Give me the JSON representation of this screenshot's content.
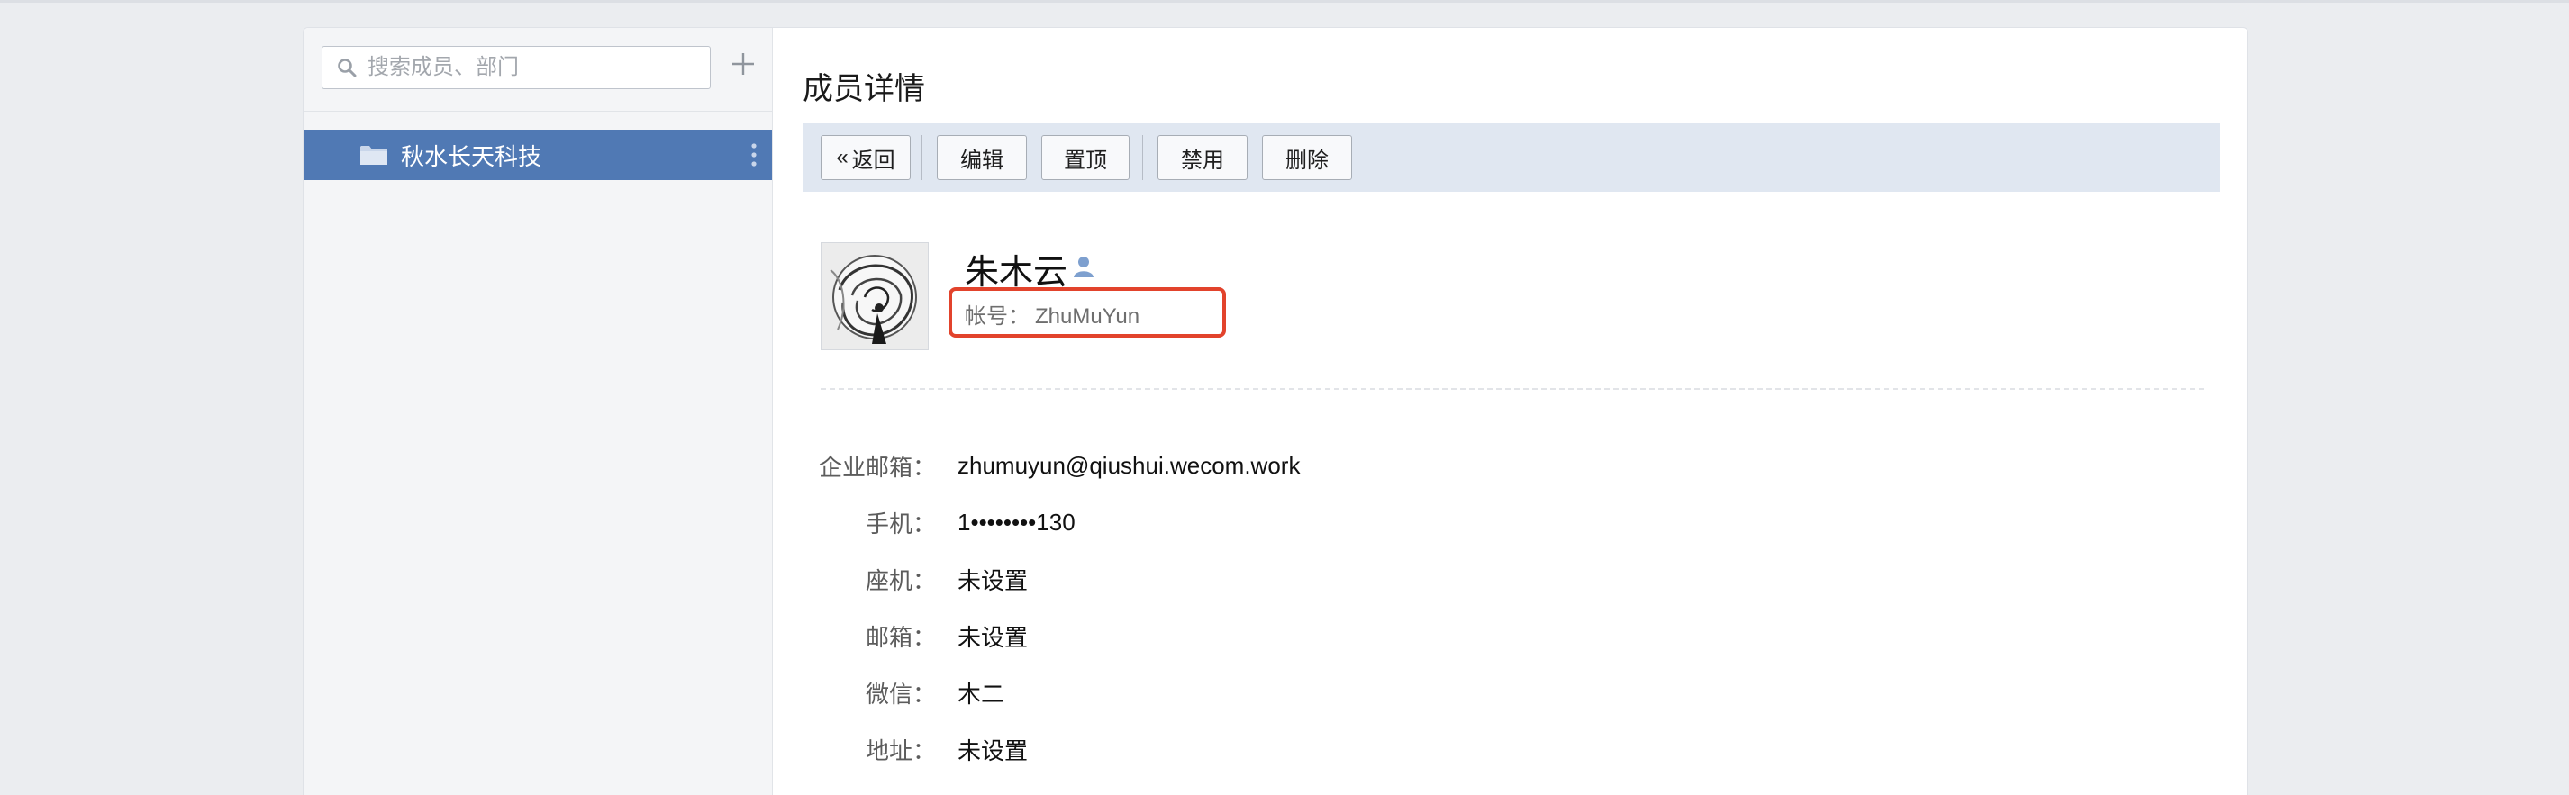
{
  "search": {
    "placeholder": "搜索成员、部门"
  },
  "sidebar": {
    "add_icon": "plus-icon",
    "departments": [
      {
        "label": "秋水长天科技",
        "icon": "folder-icon",
        "selected": true
      }
    ]
  },
  "main": {
    "title": "成员详情",
    "toolbar": {
      "back_label": "返回",
      "back_icon": "«",
      "edit_label": "编辑",
      "pin_label": "置顶",
      "disable_label": "禁用",
      "delete_label": "删除"
    },
    "profile": {
      "name": "朱木云",
      "account_label": "帐号：",
      "account_value": "ZhuMuYun"
    },
    "info": [
      {
        "label": "企业邮箱：",
        "value": "zhumuyun@qiushui.wecom.work"
      },
      {
        "label": "手机：",
        "value": "1••••••••130"
      },
      {
        "label": "座机：",
        "value": "未设置"
      },
      {
        "label": "邮箱：",
        "value": "未设置"
      },
      {
        "label": "微信：",
        "value": "木二"
      },
      {
        "label": "地址：",
        "value": "未设置"
      }
    ]
  },
  "colors": {
    "accent": "#5079b4",
    "toolbar_bg": "#e0e7f1",
    "highlight_border": "#e2432c",
    "member_icon": "#7ea0cf"
  }
}
